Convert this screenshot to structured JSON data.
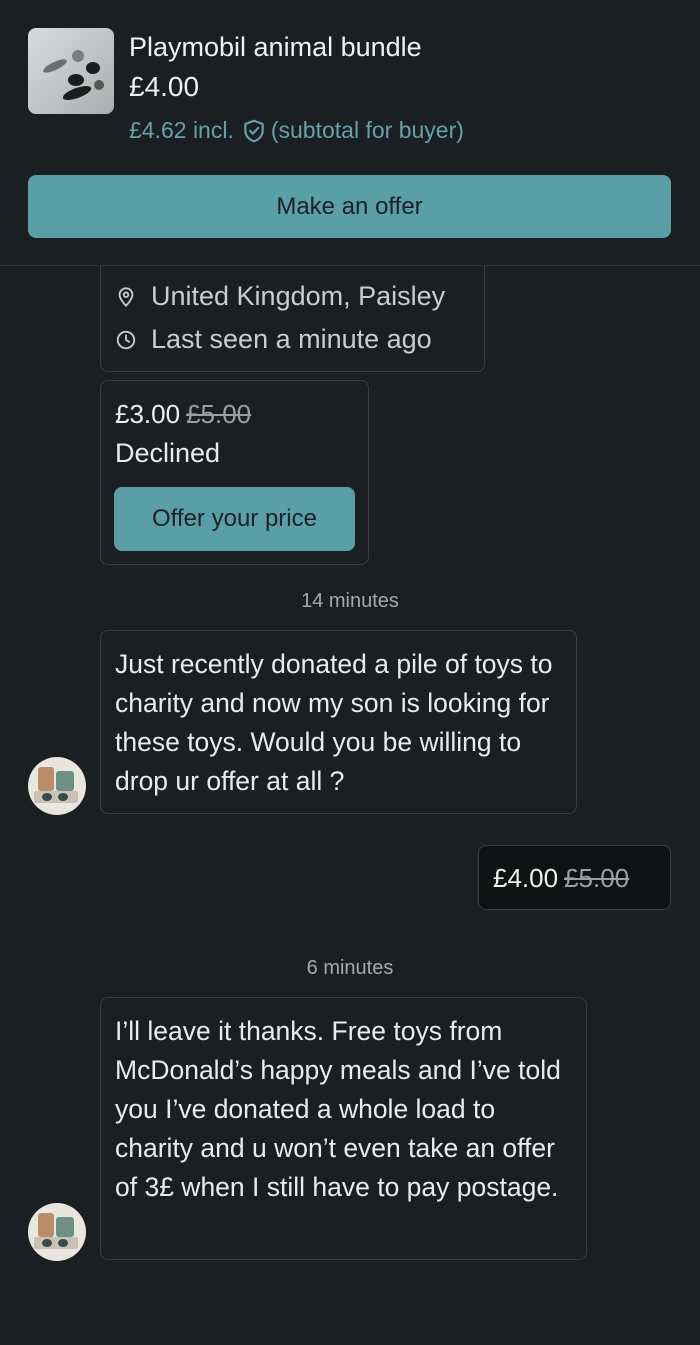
{
  "listing": {
    "title": "Playmobil animal bundle",
    "price": "£4.00",
    "price_incl": "£4.62 incl.",
    "subtotal_note": "(subtotal for buyer)",
    "protection_icon": "shield-check-icon",
    "make_offer_label": "Make an offer"
  },
  "profile": {
    "location": "United Kingdom, Paisley",
    "last_seen": "Last seen a minute ago",
    "location_icon": "map-pin-icon",
    "clock_icon": "clock-icon"
  },
  "messages": {
    "offer1": {
      "amount": "£3.00",
      "original": "£5.00",
      "status": "Declined",
      "button_label": "Offer your price"
    },
    "time1": "14 minutes",
    "msg1": "Just recently donated a pile of toys to charity and now my son is looking for these toys. Would you be willing to drop ur offer at all ?",
    "offer2": {
      "amount": "£4.00",
      "original": "£5.00"
    },
    "time2": "6 minutes",
    "msg2": "I’ll leave it thanks. Free toys from McDonald’s happy meals and I’ve told you I’ve donated a whole load to charity and u won’t even take an offer of 3£ when I still have to pay postage."
  },
  "colors": {
    "background": "#1b1f21",
    "accent": "#5a9ea7",
    "link": "#62a3ad"
  }
}
